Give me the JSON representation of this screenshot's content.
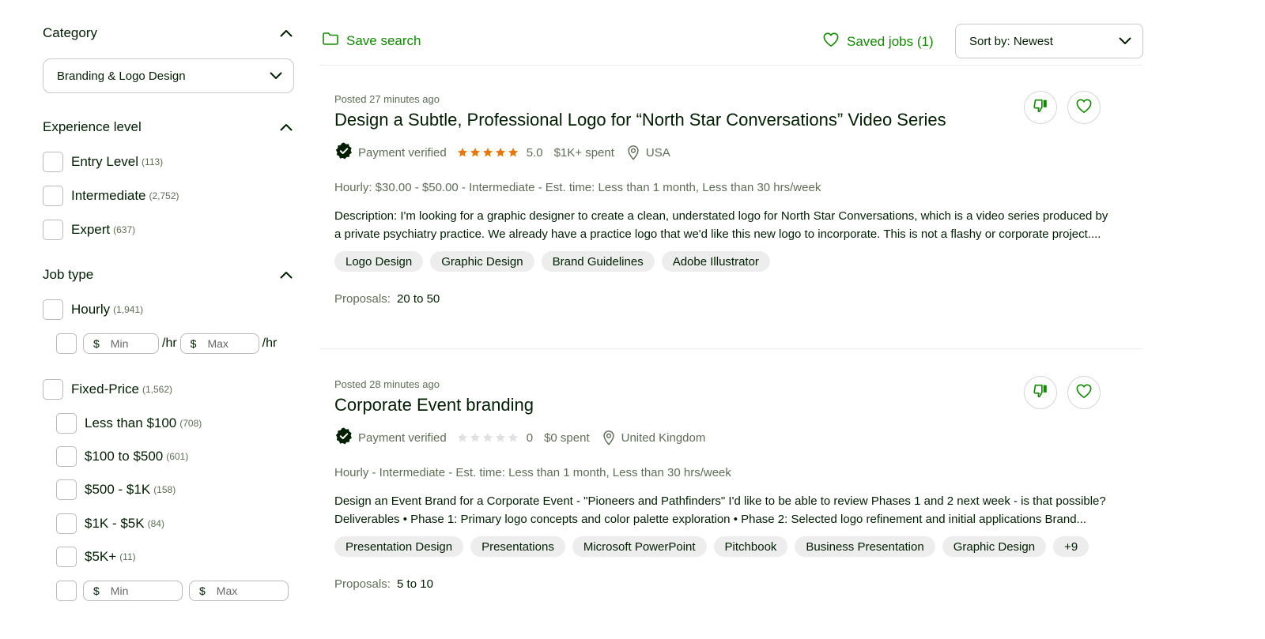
{
  "sidebar": {
    "category": {
      "title": "Category",
      "selected": "Branding & Logo Design"
    },
    "experience": {
      "title": "Experience level",
      "options": [
        {
          "label": "Entry Level",
          "count": "(113)"
        },
        {
          "label": "Intermediate",
          "count": "(2,752)"
        },
        {
          "label": "Expert",
          "count": "(637)"
        }
      ]
    },
    "job_type": {
      "title": "Job type",
      "hourly": {
        "label": "Hourly",
        "count": "(1,941)"
      },
      "hourly_range": {
        "currency": "$",
        "min_placeholder": "Min",
        "max_placeholder": "Max",
        "unit": "/hr"
      },
      "fixed": {
        "label": "Fixed-Price",
        "count": "(1,562)"
      },
      "fixed_options": [
        {
          "label": "Less than $100",
          "count": "(708)"
        },
        {
          "label": "$100 to $500",
          "count": "(601)"
        },
        {
          "label": "$500 - $1K",
          "count": "(158)"
        },
        {
          "label": "$1K - $5K",
          "count": "(84)"
        },
        {
          "label": "$5K+",
          "count": "(11)"
        }
      ],
      "fixed_range": {
        "currency": "$",
        "min_placeholder": "Min",
        "max_placeholder": "Max"
      }
    }
  },
  "topbar": {
    "save_search": "Save search",
    "saved_jobs": "Saved jobs (1)",
    "sort": "Sort by: Newest"
  },
  "jobs": [
    {
      "posted": "Posted 27 minutes ago",
      "title": "Design a Subtle, Professional Logo for “North Star Conversations” Video Series",
      "payment": "Payment verified",
      "rating": "5.0",
      "rating_value": 5,
      "spent": "$1K+ spent",
      "location": "USA",
      "budget": "Hourly: $30.00 - $50.00 - Intermediate - Est. time: Less than 1 month, Less than 30 hrs/week",
      "desc_line1": "Description: I'm looking for a graphic designer to create a clean, understated logo for North Star Conversations, which is a video series produced by",
      "desc_line2": "a private psychiatry practice. We already have a practice logo that we'd like this new logo to incorporate. This is not a flashy or corporate project....",
      "tags": [
        "Logo Design",
        "Graphic Design",
        "Brand Guidelines",
        "Adobe Illustrator"
      ],
      "proposals_label": "Proposals:",
      "proposals_value": "20 to 50"
    },
    {
      "posted": "Posted 28 minutes ago",
      "title": "Corporate Event branding",
      "payment": "Payment verified",
      "rating": "0",
      "rating_value": 0,
      "spent": "$0 spent",
      "location": "United Kingdom",
      "budget": "Hourly - Intermediate - Est. time: Less than 1 month, Less than 30 hrs/week",
      "desc_line1": "Design an Event Brand for a Corporate Event - \"Pioneers and Pathfinders\" I'd like to be able to review Phases 1 and 2 next week - is that possible?",
      "desc_line2": "Deliverables • Phase 1: Primary logo concepts and color palette exploration • Phase 2: Selected logo refinement and initial applications Brand...",
      "tags": [
        "Presentation Design",
        "Presentations",
        "Microsoft PowerPoint",
        "Pitchbook",
        "Business Presentation",
        "Graphic Design",
        "+9"
      ],
      "proposals_label": "Proposals:",
      "proposals_value": "5 to 10"
    }
  ],
  "colors": {
    "accent_green": "#108a00",
    "star_orange": "#e5780d",
    "star_empty": "#e0e0e0",
    "text_muted": "#5e6d55"
  }
}
